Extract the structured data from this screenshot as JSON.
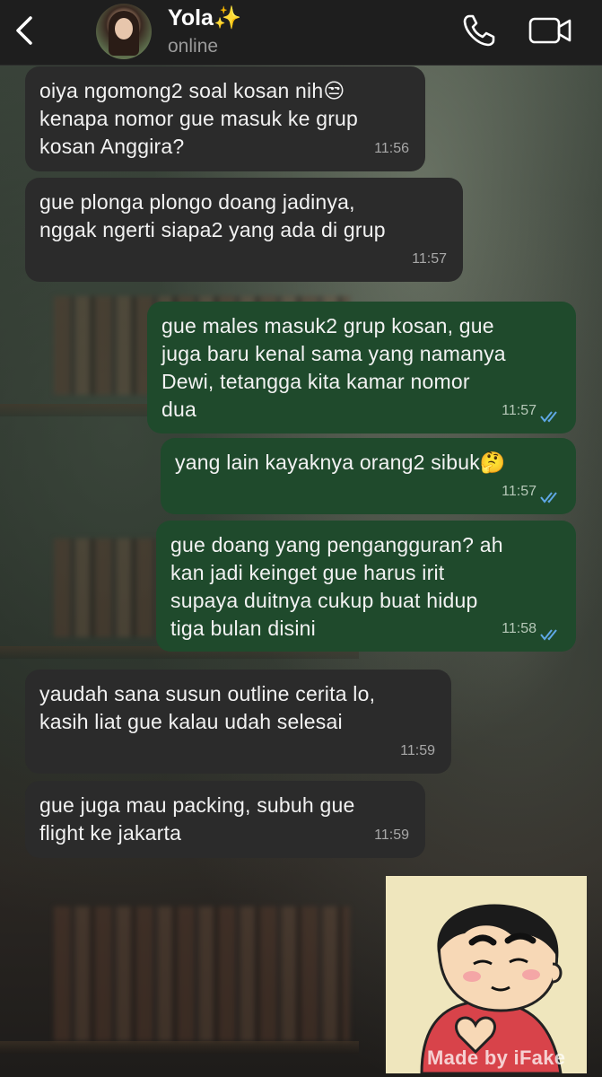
{
  "contact": {
    "name": "Yola✨",
    "status": "online"
  },
  "messages": [
    {
      "direction": "incoming",
      "text": "oiya ngomong2 soal kosan nih😒\nkenapa nomor gue masuk ke grup\nkosan Anggira?",
      "time": "11:56"
    },
    {
      "direction": "incoming",
      "text": "gue plonga plongo doang jadinya,\nnggak ngerti siapa2 yang ada di grup",
      "time": "11:57"
    },
    {
      "direction": "outgoing",
      "text": "gue males masuk2 grup kosan, gue\njuga baru kenal sama yang namanya\nDewi, tetangga kita kamar nomor\ndua",
      "time": "11:57",
      "read": true
    },
    {
      "direction": "outgoing",
      "text": "yang lain kayaknya orang2 sibuk🤔",
      "time": "11:57",
      "read": true
    },
    {
      "direction": "outgoing",
      "text": "gue doang yang pengangguran? ah\nkan jadi keinget gue harus irit\nsupaya duitnya cukup buat hidup\ntiga bulan disini",
      "time": "11:58",
      "read": true
    },
    {
      "direction": "incoming",
      "text": "yaudah sana susun outline cerita lo,\nkasih liat gue kalau udah selesai",
      "time": "11:59"
    },
    {
      "direction": "incoming",
      "text": "gue juga mau packing, subuh gue\nflight ke jakarta",
      "time": "11:59"
    }
  ],
  "sticker": {
    "icon": "crayon-shinchan-heart-sticker"
  },
  "watermark": "Made by iFake",
  "colors": {
    "header_bg": "#1e1e1e",
    "incoming_bubble": "#2b2b2b",
    "outgoing_bubble": "#1f4a2c",
    "read_ticks": "#5fa8e6"
  }
}
